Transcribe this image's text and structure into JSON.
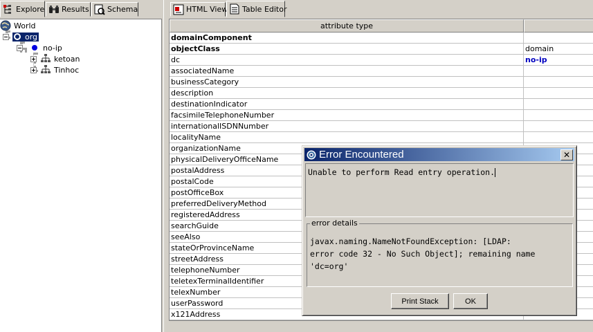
{
  "left_tabs": [
    {
      "label": "Explore",
      "icon": "explore-tree-icon",
      "active": true
    },
    {
      "label": "Results",
      "icon": "binoculars-icon",
      "active": false
    },
    {
      "label": "Schema",
      "icon": "schema-icon",
      "active": false
    }
  ],
  "tree": {
    "root": "World",
    "selected": "org",
    "child": "no-ip",
    "leaves": [
      "ketoan",
      "Tinhoc"
    ]
  },
  "right_tabs": [
    {
      "label": "HTML View",
      "icon": "html-view-icon",
      "active": false
    },
    {
      "label": "Table Editor",
      "icon": "table-editor-icon",
      "active": true
    }
  ],
  "table": {
    "header": "attribute type",
    "header_value": "",
    "rows": [
      {
        "attr": "domainComponent",
        "value": "",
        "bold": true
      },
      {
        "attr": "objectClass",
        "value": "domain",
        "bold": true
      },
      {
        "attr": "dc",
        "value": "no-ip",
        "bold": false
      },
      {
        "attr": "associatedName",
        "value": ""
      },
      {
        "attr": "businessCategory",
        "value": ""
      },
      {
        "attr": "description",
        "value": ""
      },
      {
        "attr": "destinationIndicator",
        "value": ""
      },
      {
        "attr": "facsimileTelephoneNumber",
        "value": ""
      },
      {
        "attr": "internationalISDNNumber",
        "value": ""
      },
      {
        "attr": "localityName",
        "value": ""
      },
      {
        "attr": "organizationName",
        "value": ""
      },
      {
        "attr": "physicalDeliveryOfficeName",
        "value": ""
      },
      {
        "attr": "postalAddress",
        "value": ""
      },
      {
        "attr": "postalCode",
        "value": ""
      },
      {
        "attr": "postOfficeBox",
        "value": ""
      },
      {
        "attr": "preferredDeliveryMethod",
        "value": ""
      },
      {
        "attr": "registeredAddress",
        "value": ""
      },
      {
        "attr": "searchGuide",
        "value": ""
      },
      {
        "attr": "seeAlso",
        "value": ""
      },
      {
        "attr": "stateOrProvinceName",
        "value": ""
      },
      {
        "attr": "streetAddress",
        "value": ""
      },
      {
        "attr": "telephoneNumber",
        "value": ""
      },
      {
        "attr": "teletexTerminalIdentifier",
        "value": ""
      },
      {
        "attr": "telexNumber",
        "value": ""
      },
      {
        "attr": "userPassword",
        "value": ""
      },
      {
        "attr": "x121Address",
        "value": ""
      }
    ]
  },
  "dialog": {
    "title": "Error Encountered",
    "message": "Unable to perform Read entry operation.",
    "details_label": "error details",
    "details_lines": [
      "javax.naming.NameNotFoundException: [LDAP:",
      "error code 32 - No Such Object]; remaining name",
      "'dc=org'"
    ],
    "print_stack_label": "Print Stack",
    "ok_label": "OK"
  },
  "colors": {
    "title_gradient_start": "#0a246a",
    "title_gradient_end": "#a6caf0",
    "selection": "#0a246a",
    "link_value": "#0000c0"
  }
}
